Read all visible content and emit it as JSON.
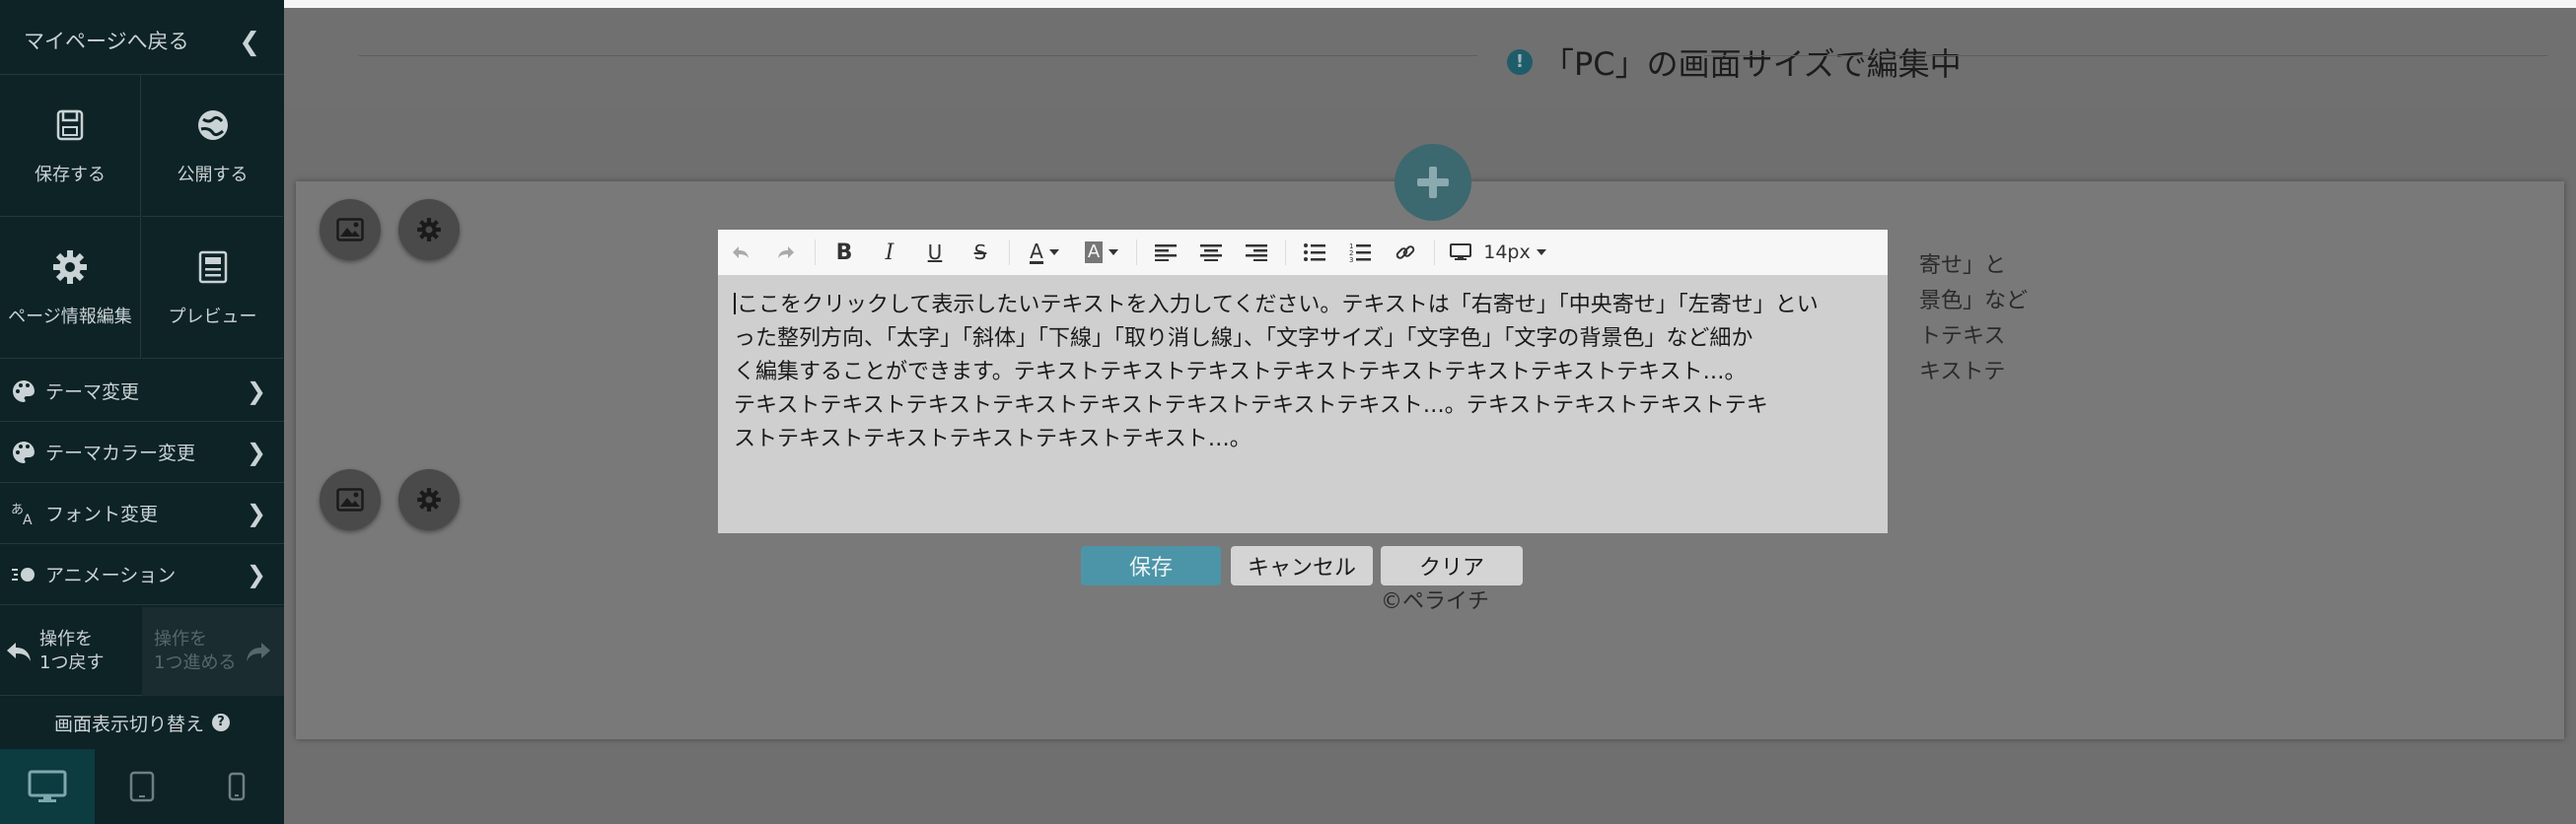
{
  "sidebar": {
    "back_label": "マイページへ戻る",
    "save_label": "保存する",
    "publish_label": "公開する",
    "page_info_label": "ページ情報編集",
    "preview_label": "プレビュー",
    "menu": [
      {
        "label": "テーマ変更",
        "icon": "palette-icon"
      },
      {
        "label": "テーマカラー変更",
        "icon": "palette-icon"
      },
      {
        "label": "フォント変更",
        "icon": "font-icon"
      },
      {
        "label": "アニメーション",
        "icon": "animation-icon"
      }
    ],
    "undo_label_1": "操作を",
    "undo_label_2": "1つ戻す",
    "redo_label_1": "操作を",
    "redo_label_2": "1つ進める",
    "display_switch_label": "画面表示切り替え",
    "help_glyph": "?"
  },
  "header": {
    "title": "「PC」の画面サイズで編集中",
    "notice_glyph": "!"
  },
  "editor": {
    "font_size": "14px",
    "text": "ここをクリックして表示したいテキストを入力してください。テキストは「右寄せ」「中央寄せ」「左寄せ」といった整列方向、「太字」「斜体」「下線」「取り消し線」、「文字サイズ」「文字色」「文字の背景色」など細かく編集することができます。テキストテキストテキストテキストテキストテキストテキストテキスト…。テキストテキストテキストテキストテキストテキストテキストテキスト…。テキストテキストテキストテキストテキストテキストテキストテキスト…。",
    "lines": [
      "ここをクリックして表示したいテキストを入力してください。テキストは「右寄せ」「中央寄せ」「左寄せ」とい",
      "った整列方向、「太字」「斜体」「下線」「取り消し線」、「文字サイズ」「文字色」「文字の背景色」など細か",
      "く編集することができます。テキストテキストテキストテキストテキストテキストテキストテキスト…。",
      "テキストテキストテキストテキストテキストテキストテキストテキスト…。テキストテキストテキストテキ",
      "ストテキストテキストテキストテキストテキスト…。"
    ],
    "save_button": "保存",
    "cancel_button": "キャンセル",
    "clear_button": "クリア"
  },
  "background": {
    "text_lines": [
      "寄せ」と",
      "景色」など",
      "トテキス",
      "キストテ"
    ],
    "copyright": "©ペライチ"
  },
  "colors": {
    "sidebar_bg": "#0e2326",
    "accent": "#4c95a8"
  }
}
